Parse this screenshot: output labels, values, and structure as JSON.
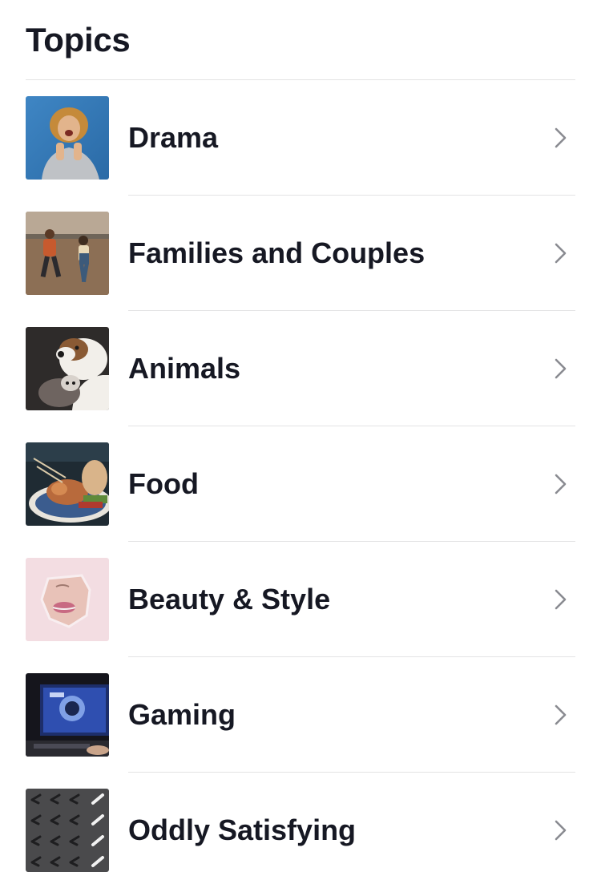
{
  "header": {
    "title": "Topics"
  },
  "topics": [
    {
      "label": "Drama",
      "thumbnail": "woman-laughing-blue-background",
      "chevron_icon": "chevron-right-icon"
    },
    {
      "label": "Families and Couples",
      "thumbnail": "couple-running-field",
      "chevron_icon": "chevron-right-icon"
    },
    {
      "label": "Animals",
      "thumbnail": "dog-and-cat",
      "chevron_icon": "chevron-right-icon"
    },
    {
      "label": "Food",
      "thumbnail": "food-platter",
      "chevron_icon": "chevron-right-icon"
    },
    {
      "label": "Beauty & Style",
      "thumbnail": "face-through-paper",
      "chevron_icon": "chevron-right-icon"
    },
    {
      "label": "Gaming",
      "thumbnail": "gaming-monitor",
      "chevron_icon": "chevron-right-icon"
    },
    {
      "label": "Oddly Satisfying",
      "thumbnail": "pattern-grid",
      "chevron_icon": "chevron-right-icon"
    }
  ],
  "colors": {
    "text": "#161823",
    "divider": "#e3e3e4",
    "chevron": "#8a8b91",
    "background": "#ffffff"
  }
}
